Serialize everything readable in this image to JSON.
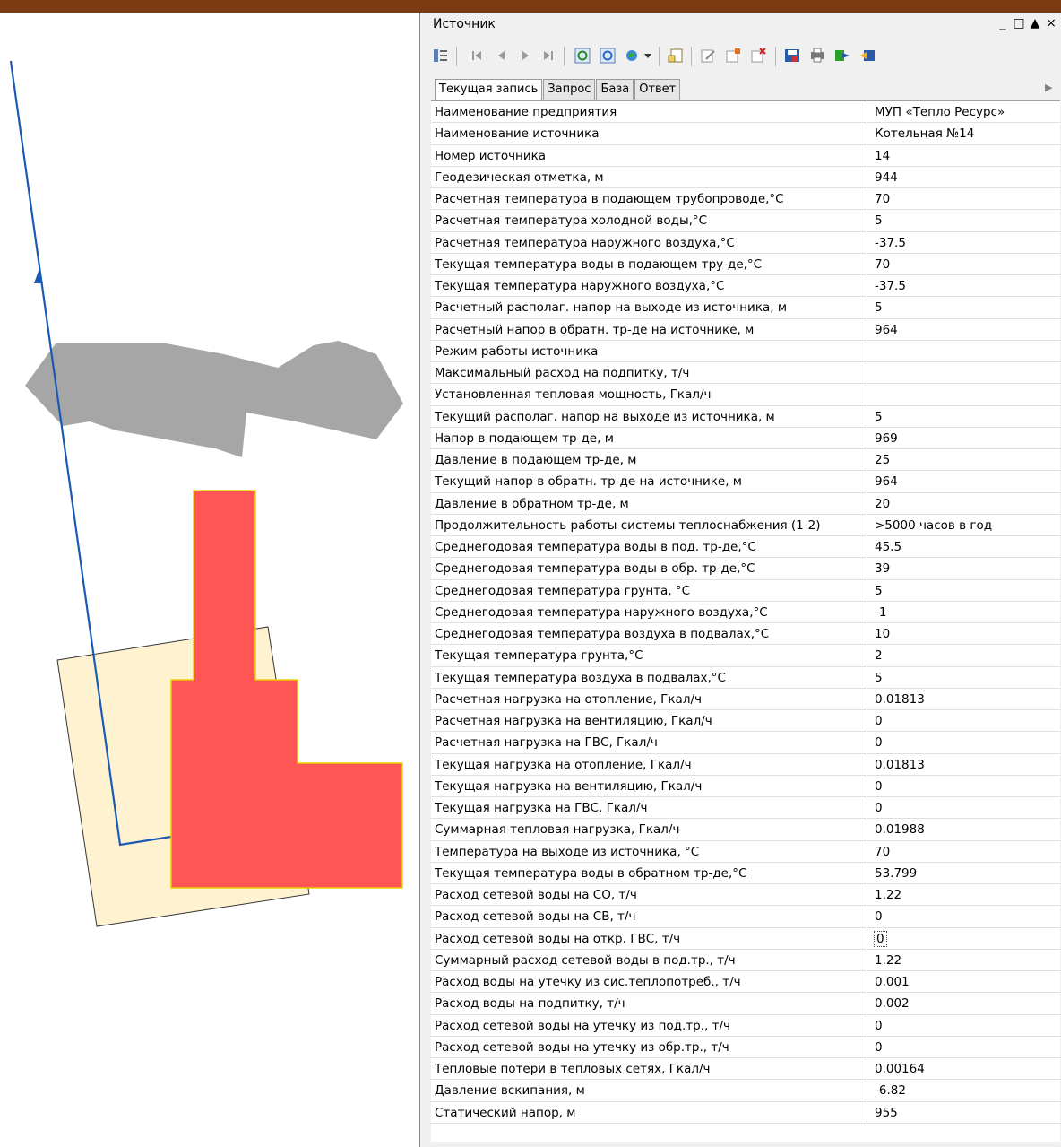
{
  "window": {
    "title": "Источник",
    "controls": [
      "_",
      "□",
      "▲",
      "×"
    ]
  },
  "toolbar": {
    "icons": [
      "columns-icon",
      "first-record-icon",
      "prev-record-icon",
      "next-record-icon",
      "last-record-icon",
      "refresh-icon",
      "refresh-all-icon",
      "locate-icon",
      "dropdown-icon",
      "new-record-icon",
      "edit-record-icon",
      "add-record-icon",
      "delete-record-icon",
      "save-icon",
      "print-icon",
      "export-icon",
      "import-icon"
    ]
  },
  "tabs": [
    {
      "label": "Текущая запись",
      "active": true
    },
    {
      "label": "Запрос",
      "active": false
    },
    {
      "label": "База",
      "active": false
    },
    {
      "label": "Ответ",
      "active": false
    }
  ],
  "properties": [
    {
      "name": "Наименование предприятия",
      "value": "МУП «Тепло Ресурс»"
    },
    {
      "name": "Наименование источника",
      "value": "Котельная №14"
    },
    {
      "name": "Номер источника",
      "value": "14"
    },
    {
      "name": "Геодезическая отметка, м",
      "value": "944"
    },
    {
      "name": "Расчетная температура в подающем трубопроводе,°С",
      "value": "70"
    },
    {
      "name": "Расчетная температура холодной воды,°С",
      "value": "5"
    },
    {
      "name": "Расчетная температура наружного воздуха,°С",
      "value": "-37.5"
    },
    {
      "name": "Текущая температура воды в подающем тру-де,°С",
      "value": "70"
    },
    {
      "name": "Текущая температура  наружного воздуха,°С",
      "value": "-37.5"
    },
    {
      "name": "Расчетный располаг. напор на выходе из источника, м",
      "value": "5"
    },
    {
      "name": "Расчетный напор в обратн. тр-де на источнике, м",
      "value": "964"
    },
    {
      "name": "Режим работы источника",
      "value": ""
    },
    {
      "name": "Максимальный расход на подпитку, т/ч",
      "value": ""
    },
    {
      "name": "Установленная тепловая мощность, Гкал/ч",
      "value": ""
    },
    {
      "name": "Текущий располаг. напор на выходе из источника, м",
      "value": "5"
    },
    {
      "name": "Напор в подающем тр-де, м",
      "value": "969"
    },
    {
      "name": "Давление в подающем тр-де, м",
      "value": "25"
    },
    {
      "name": "Текущий напор в обратн. тр-де на источнике, м",
      "value": "964"
    },
    {
      "name": "Давление в обратном тр-де, м",
      "value": "20"
    },
    {
      "name": "Продолжительность работы системы теплоснабжения (1-2)",
      "value": ">5000 часов в год"
    },
    {
      "name": "Среднегодовая температура воды в под. тр-де,°С",
      "value": "45.5"
    },
    {
      "name": "Среднегодовая температура воды в обр. тр-де,°С",
      "value": "39"
    },
    {
      "name": "Среднегодовая температура грунта, °С",
      "value": "5"
    },
    {
      "name": "Среднегодовая температура наружного воздуха,°С",
      "value": "-1"
    },
    {
      "name": "Среднегодовая температура воздуха в подвалах,°С",
      "value": "10"
    },
    {
      "name": "Текущая температура грунта,°С",
      "value": "2"
    },
    {
      "name": "Текущая температура воздуха в подвалах,°С",
      "value": "5"
    },
    {
      "name": "Расчетная нагрузка на отопление, Гкал/ч",
      "value": "0.01813"
    },
    {
      "name": "Расчетная нагрузка на вентиляцию, Гкал/ч",
      "value": "0"
    },
    {
      "name": "Расчетная нагрузка на ГВС, Гкал/ч",
      "value": "0"
    },
    {
      "name": "Текущая нагрузка на отопление, Гкал/ч",
      "value": "0.01813"
    },
    {
      "name": "Текущая нагрузка на вентиляцию, Гкал/ч",
      "value": "0"
    },
    {
      "name": "Текущая нагрузка на ГВС, Гкал/ч",
      "value": "0"
    },
    {
      "name": "Суммарная тепловая нагрузка, Гкал/ч",
      "value": "0.01988"
    },
    {
      "name": "Температура на выходе из источника, °С",
      "value": "70"
    },
    {
      "name": "Текущая температура воды в обратном тр-де,°С",
      "value": "53.799"
    },
    {
      "name": "Расход сетевой воды на СО, т/ч",
      "value": "1.22"
    },
    {
      "name": "Расход сетевой воды на СВ, т/ч",
      "value": "0"
    },
    {
      "name": "Расход сетевой воды на откр. ГВС, т/ч",
      "value": "0",
      "selected": true
    },
    {
      "name": "Суммарный расход сетевой воды в под.тр., т/ч",
      "value": "1.22"
    },
    {
      "name": "Расход воды на утечку из сис.теплопотреб., т/ч",
      "value": "0.001"
    },
    {
      "name": "Расход воды на подпитку, т/ч",
      "value": "0.002"
    },
    {
      "name": "Расход сетевой воды на утечку из под.тр., т/ч",
      "value": "0"
    },
    {
      "name": "Расход сетевой воды на утечку из обр.тр., т/ч",
      "value": "0"
    },
    {
      "name": "Тепловые потери в тепловых сетях, Гкал/ч",
      "value": "0.00164"
    },
    {
      "name": "Давление вскипания, м",
      "value": "-6.82"
    },
    {
      "name": "Статический напор, м",
      "value": "955"
    }
  ],
  "map": {
    "pipeline_color": "#1a5ab4",
    "building_fill": "#ff5555",
    "building_stroke": "#e8d000",
    "lot_fill": "#fff2d0",
    "area_fill": "#a6a6a6"
  }
}
